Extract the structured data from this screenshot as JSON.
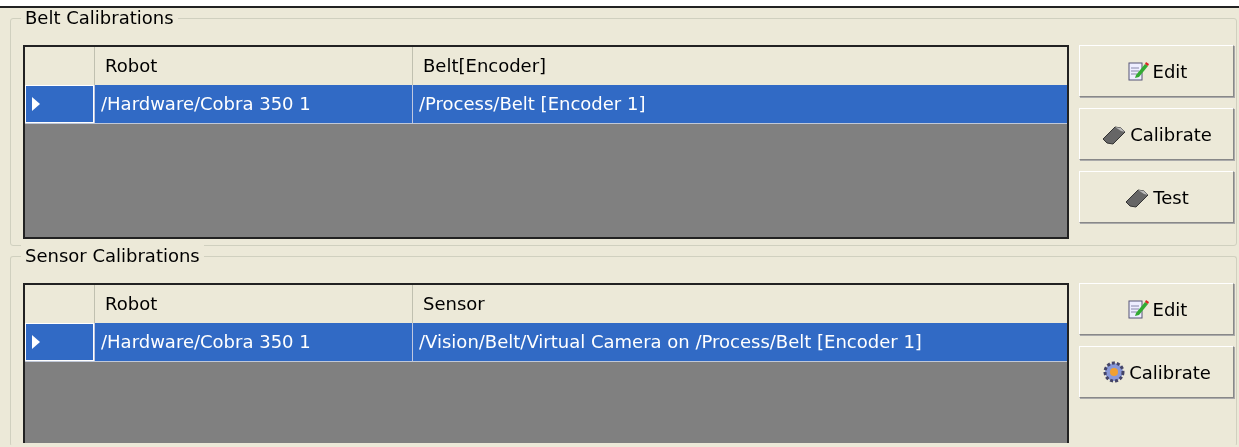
{
  "groups": [
    {
      "title": "Belt Calibrations",
      "columns": [
        "Robot",
        "Belt[Encoder]"
      ],
      "rows": [
        {
          "cells": [
            "/Hardware/Cobra 350 1",
            "/Process/Belt [Encoder 1]"
          ],
          "selected": true
        }
      ],
      "buttons": [
        {
          "label": "Edit",
          "kind": "edit"
        },
        {
          "label": "Calibrate",
          "kind": "wrench"
        },
        {
          "label": "Test",
          "kind": "wrench"
        }
      ]
    },
    {
      "title": "Sensor Calibrations",
      "columns": [
        "Robot",
        "Sensor"
      ],
      "rows": [
        {
          "cells": [
            "/Hardware/Cobra 350 1",
            "/Vision/Belt/Virtual Camera on /Process/Belt [Encoder 1]"
          ],
          "selected": true
        }
      ],
      "buttons": [
        {
          "label": "Edit",
          "kind": "edit"
        },
        {
          "label": "Calibrate",
          "kind": "gear"
        }
      ]
    }
  ]
}
